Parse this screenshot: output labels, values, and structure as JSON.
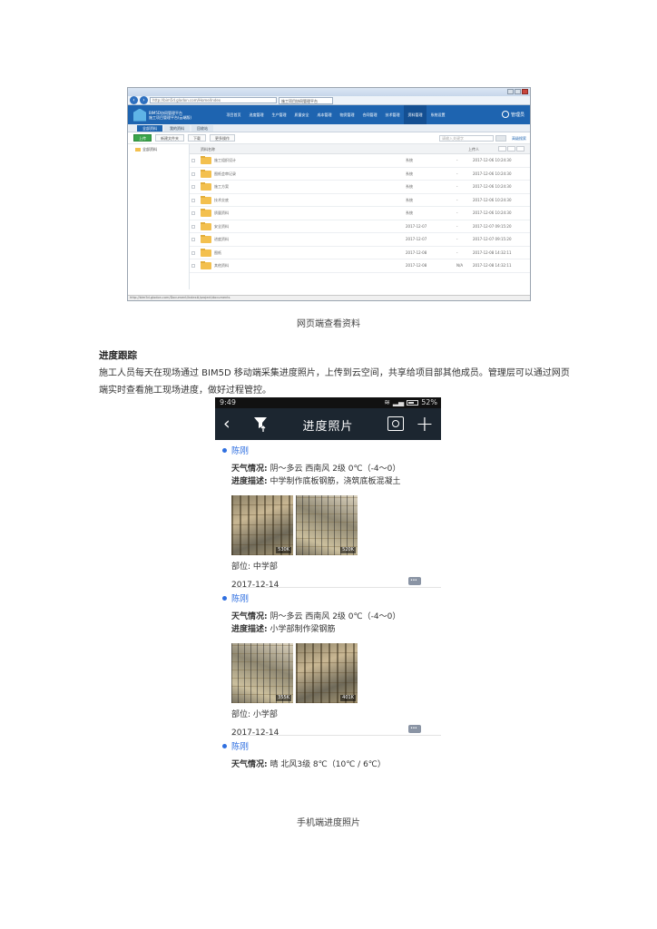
{
  "browser": {
    "address": "http://bim5d.glodon.com/Home/Index",
    "tab_title": "施工项目协同管理平台",
    "brand_line1": "BIM5D协同管理平台",
    "brand_line2": "施工项目管理平台(云端版)",
    "menu": [
      "项目首页",
      "进度管理",
      "生产管理",
      "质量安全",
      "成本管理",
      "物资管理",
      "合同管理",
      "技术管理",
      "资料管理",
      "系统设置"
    ],
    "user": "管理员",
    "subnav": [
      "全部资料",
      "我的资料",
      "回收站"
    ],
    "toolbar": {
      "upload": "上传",
      "new_folder": "新建文件夹",
      "download": "下载",
      "more": "更多操作"
    },
    "search_placeholder": "请输入关键字",
    "advanced": "高级搜索",
    "tree_root": "全部资料",
    "grid_header": {
      "name": "资料名称",
      "uploader": "上传人"
    },
    "files": [
      {
        "name": "施工组织设计",
        "owner": "系统",
        "size": "-",
        "date": "2017-12-06 10:24:30"
      },
      {
        "name": "图纸会审记录",
        "owner": "系统",
        "size": "-",
        "date": "2017-12-06 10:24:30"
      },
      {
        "name": "施工方案",
        "owner": "系统",
        "size": "-",
        "date": "2017-12-06 10:24:30"
      },
      {
        "name": "技术交底",
        "owner": "系统",
        "size": "-",
        "date": "2017-12-06 10:24:30"
      },
      {
        "name": "质量资料",
        "owner": "系统",
        "size": "-",
        "date": "2017-12-06 10:24:30"
      },
      {
        "name": "安全资料",
        "owner": "2017-12-07",
        "size": "-",
        "date": "2017-12-07 09:15:20"
      },
      {
        "name": "进度资料",
        "owner": "2017-12-07",
        "size": "-",
        "date": "2017-12-07 09:15:20"
      },
      {
        "name": "图纸",
        "owner": "2017-12-08",
        "size": "-",
        "date": "2017-12-08 14:32:11"
      },
      {
        "name": "其他资料",
        "owner": "2017-12-08",
        "size": "N/A",
        "date": "2017-12-08 14:32:11"
      }
    ],
    "status_url": "http://bim5d.glodon.com/Document/Index#/project/documents"
  },
  "captions": {
    "web": "网页端查看资料",
    "mobile": "手机端进度照片"
  },
  "section": {
    "heading": "进度跟踪",
    "paragraph": "施工人员每天在现场通过 BIM5D 移动端采集进度照片，上传到云空间，共享给项目部其他成员。管理层可以通过网页端实时查看施工现场进度，做好过程管控。"
  },
  "phone": {
    "status_time": "9:49",
    "status_battery": "52%",
    "title": "进度照片",
    "entries": [
      {
        "author": "陈刚",
        "weather_label": "天气情况:",
        "weather": "阴～多云  西南风 2级  0℃（-4～0）",
        "desc_label": "进度描述:",
        "desc": "中学制作底板钢筋，浇筑底板混凝土",
        "photo_sizes": [
          "530K",
          "520K"
        ],
        "location_label": "部位:",
        "location": "中学部",
        "date": "2017-12-14"
      },
      {
        "author": "陈刚",
        "weather_label": "天气情况:",
        "weather": "阴～多云  西南风 2级  0℃（-4～0）",
        "desc_label": "进度描述:",
        "desc": "小学部制作梁钢筋",
        "photo_sizes": [
          "355K",
          "401K"
        ],
        "location_label": "部位:",
        "location": "小学部",
        "date": "2017-12-14"
      },
      {
        "author": "陈刚",
        "weather_label": "天气情况:",
        "weather": "晴  北风3级  8℃（10℃ / 6℃）"
      }
    ]
  }
}
